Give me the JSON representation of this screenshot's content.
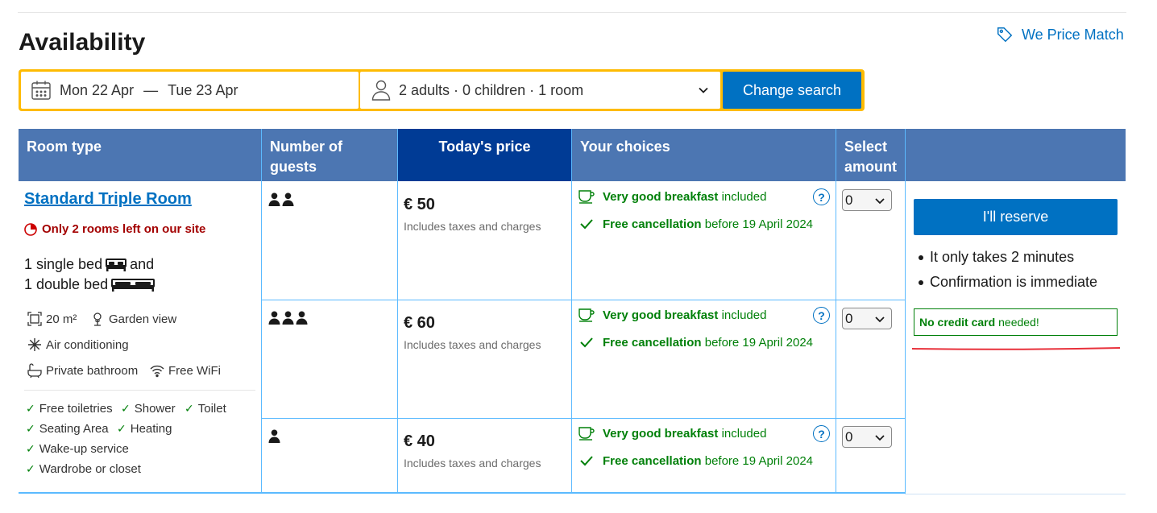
{
  "header": {
    "title": "Availability",
    "price_match": "We Price Match"
  },
  "search": {
    "check_in": "Mon 22 Apr",
    "dash": "—",
    "check_out": "Tue 23 Apr",
    "guests": "2 adults · 0 children · 1 room",
    "button": "Change search"
  },
  "table": {
    "headers": {
      "room_type": "Room type",
      "guests": "Number of guests",
      "price": "Today's price",
      "choices": "Your choices",
      "select": "Select amount"
    },
    "room": {
      "name": "Standard Triple Room",
      "scarcity": "Only 2 rooms left on our site",
      "bed_line1": "1 single bed",
      "bed_and": "and",
      "bed_line2": "1 double bed",
      "size": "20 m²",
      "view": "Garden view",
      "ac": "Air conditioning",
      "bathroom": "Private bathroom",
      "wifi": "Free WiFi",
      "amenities": [
        "Free toiletries",
        "Shower",
        "Toilet",
        "Seating Area",
        "Heating",
        "Wake-up service",
        "Wardrobe or closet"
      ]
    },
    "rows": [
      {
        "guests": 2,
        "price": "€ 50",
        "taxes": "Includes taxes and charges",
        "breakfast_bold": "Very good breakfast",
        "breakfast_rest": "included",
        "cancel_bold": "Free cancellation",
        "cancel_rest": "before 19 April 2024",
        "amount": "0"
      },
      {
        "guests": 3,
        "price": "€ 60",
        "taxes": "Includes taxes and charges",
        "breakfast_bold": "Very good breakfast",
        "breakfast_rest": "included",
        "cancel_bold": "Free cancellation",
        "cancel_rest": "before 19 April 2024",
        "amount": "0"
      },
      {
        "guests": 1,
        "price": "€ 40",
        "taxes": "Includes taxes and charges",
        "breakfast_bold": "Very good breakfast",
        "breakfast_rest": "included",
        "cancel_bold": "Free cancellation",
        "cancel_rest": "before 19 April 2024",
        "amount": "0"
      }
    ]
  },
  "reserve": {
    "button": "I'll reserve",
    "bullets": [
      "It only takes 2 minutes",
      "Confirmation is immediate"
    ],
    "no_cc_bold": "No credit card",
    "no_cc_rest": "needed!"
  },
  "colors": {
    "primary": "#0071c2",
    "header": "#4c76b2",
    "header_dark": "#003b95",
    "green": "#008009",
    "red": "#a30000",
    "yellow": "#febb02",
    "annotation": "#e8303a"
  }
}
